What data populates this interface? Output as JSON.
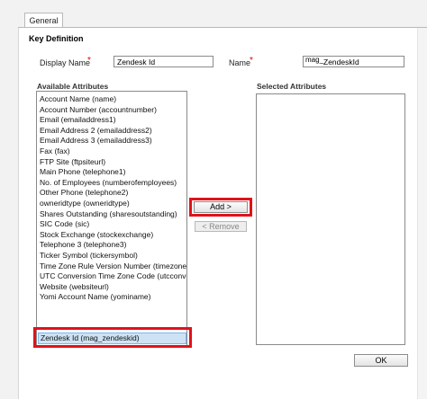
{
  "tabs": [
    {
      "label": "General"
    }
  ],
  "section": {
    "title": "Key Definition"
  },
  "display_name": {
    "label": "Display Name",
    "required_mark": "*",
    "value": "Zendesk Id"
  },
  "name": {
    "label": "Name",
    "required_mark": "*",
    "prefix": "mag_",
    "value": "ZendeskId"
  },
  "available": {
    "title": "Available Attributes",
    "items": [
      "Account Name (name)",
      "Account Number (accountnumber)",
      "Email (emailaddress1)",
      "Email Address 2 (emailaddress2)",
      "Email Address 3 (emailaddress3)",
      "Fax (fax)",
      "FTP Site (ftpsiteurl)",
      "Main Phone (telephone1)",
      "No. of Employees (numberofemployees)",
      "Other Phone (telephone2)",
      "owneridtype (owneridtype)",
      "Shares Outstanding (sharesoutstanding)",
      "SIC Code (sic)",
      "Stock Exchange (stockexchange)",
      "Telephone 3 (telephone3)",
      "Ticker Symbol (tickersymbol)",
      "Time Zone Rule Version Number (timezoneruleversionnumber)",
      "UTC Conversion Time Zone Code (utcconversiontimezonecode)",
      "Website (websiteurl)",
      "Yomi Account Name (yominame)",
      "Zendesk Id (mag_zendeskid)"
    ],
    "selected_index": 20
  },
  "selected": {
    "title": "Selected Attributes",
    "items": []
  },
  "buttons": {
    "add": "Add >",
    "remove": "< Remove",
    "ok": "OK"
  },
  "colors": {
    "highlight": "#e0121a",
    "required": "#e00000",
    "selection": "#cde3f5"
  }
}
